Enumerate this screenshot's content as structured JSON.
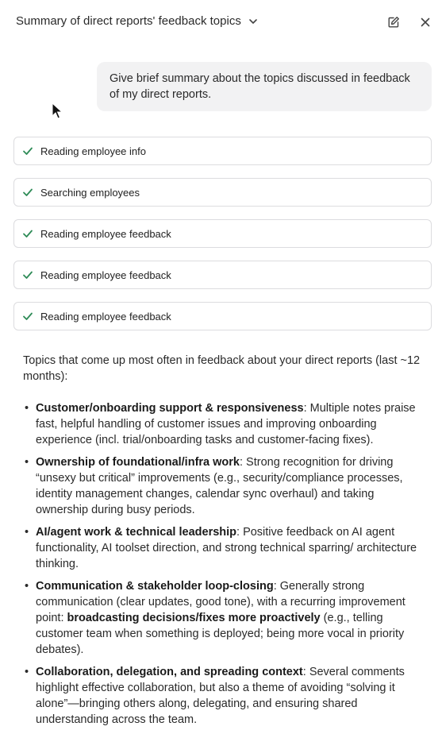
{
  "header": {
    "title": "Summary of direct reports' feedback topics",
    "icons": [
      "chevron-down-icon",
      "edit-icon",
      "close-icon"
    ]
  },
  "user_message": "Give brief summary about the topics discussed in feedback of my direct reports.",
  "steps": [
    {
      "label": "Reading employee info",
      "status": "done"
    },
    {
      "label": "Searching employees",
      "status": "done"
    },
    {
      "label": "Reading employee feedback",
      "status": "done"
    },
    {
      "label": "Reading employee feedback",
      "status": "done"
    },
    {
      "label": "Reading employee feedback",
      "status": "done"
    }
  ],
  "answer": {
    "intro": "Topics that come up most often in feedback about your direct reports (last ~12 months):",
    "bullets": [
      {
        "title": "Customer/onboarding support & responsiveness",
        "text": ": Multiple notes praise fast, helpful handling of customer issues and improving onboarding experience (incl. trial/onboarding tasks and customer-facing fixes)."
      },
      {
        "title": "Ownership of foundational/infra work",
        "text": ": Strong recognition for driving “unsexy but critical” improvements (e.g., security/compliance processes, identity management changes, calendar sync overhaul) and taking ownership during busy periods."
      },
      {
        "title": "AI/agent work & technical leadership",
        "text": ": Positive feedback on AI agent functionality, AI toolset direction, and strong technical sparring/ architecture thinking."
      },
      {
        "title": "Communication & stakeholder loop-closing",
        "text": ": Generally strong communication (clear updates, good tone), with a recurring improvement point: ",
        "emphasis": "broadcasting decisions/fixes more proactively",
        "text_after": " (e.g., telling customer team when something is deployed; being more vocal in priority debates)."
      },
      {
        "title": "Collaboration, delegation, and spreading context",
        "text": ": Several comments highlight effective collaboration, but also a theme of avoiding “solving it alone”—bringing others along, delegating, and ensuring shared understanding across the team."
      }
    ]
  },
  "colors": {
    "check": "#2e8b57",
    "user_bubble": "#f2f2f3",
    "step_border": "#dcdcdf"
  }
}
